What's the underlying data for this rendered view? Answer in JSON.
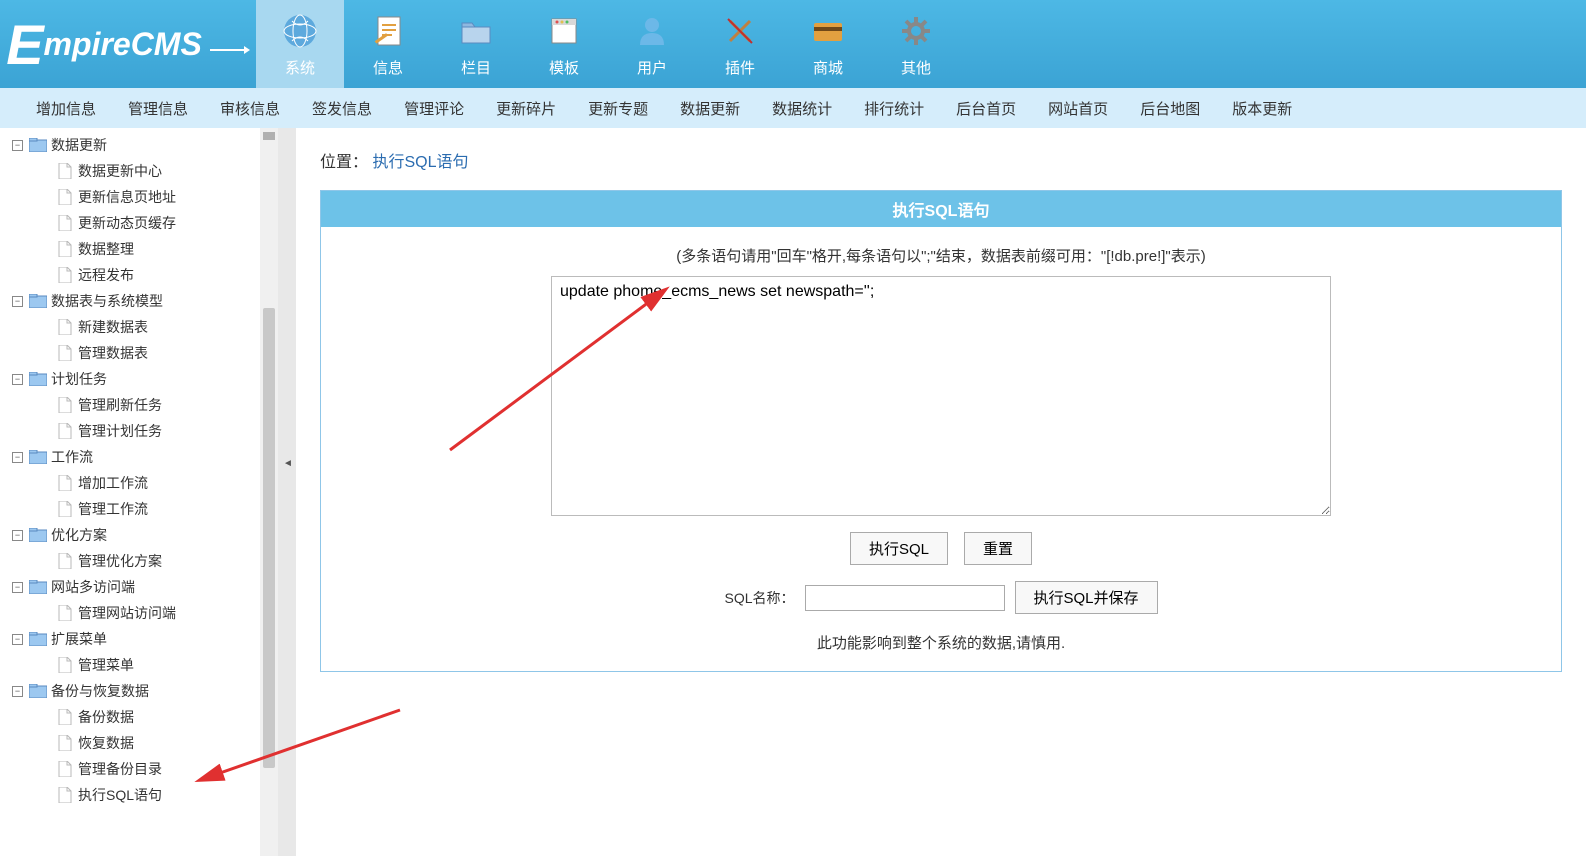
{
  "logo": "EmpireCMS",
  "topnav": [
    {
      "label": "系统",
      "icon": "globe",
      "active": true
    },
    {
      "label": "信息",
      "icon": "document"
    },
    {
      "label": "栏目",
      "icon": "folder"
    },
    {
      "label": "模板",
      "icon": "window"
    },
    {
      "label": "用户",
      "icon": "user"
    },
    {
      "label": "插件",
      "icon": "plugin"
    },
    {
      "label": "商城",
      "icon": "card"
    },
    {
      "label": "其他",
      "icon": "gear"
    }
  ],
  "subnav": [
    "增加信息",
    "管理信息",
    "审核信息",
    "签发信息",
    "管理评论",
    "更新碎片",
    "更新专题",
    "数据更新",
    "数据统计",
    "排行统计",
    "后台首页",
    "网站首页",
    "后台地图",
    "版本更新"
  ],
  "tree": [
    {
      "type": "node",
      "label": "数据更新",
      "children": [
        "数据更新中心",
        "更新信息页地址",
        "更新动态页缓存",
        "数据整理",
        "远程发布"
      ]
    },
    {
      "type": "node",
      "label": "数据表与系统模型",
      "children": [
        "新建数据表",
        "管理数据表"
      ]
    },
    {
      "type": "node",
      "label": "计划任务",
      "children": [
        "管理刷新任务",
        "管理计划任务"
      ]
    },
    {
      "type": "node",
      "label": "工作流",
      "children": [
        "增加工作流",
        "管理工作流"
      ]
    },
    {
      "type": "node",
      "label": "优化方案",
      "children": [
        "管理优化方案"
      ]
    },
    {
      "type": "node",
      "label": "网站多访问端",
      "children": [
        "管理网站访问端"
      ]
    },
    {
      "type": "node",
      "label": "扩展菜单",
      "children": [
        "管理菜单"
      ]
    },
    {
      "type": "node",
      "label": "备份与恢复数据",
      "children": [
        "备份数据",
        "恢复数据",
        "管理备份目录",
        "执行SQL语句"
      ]
    }
  ],
  "breadcrumb": {
    "label": "位置：",
    "page": "执行SQL语句"
  },
  "panel": {
    "title": "执行SQL语句",
    "hint": "(多条语句请用\"回车\"格开,每条语句以\";\"结束，数据表前缀可用：\"[!db.pre!]\"表示)",
    "sql_value": "update phome_ecms_news set newspath='';",
    "exec_btn": "执行SQL",
    "reset_btn": "重置",
    "name_label": "SQL名称：",
    "name_value": "",
    "save_btn": "执行SQL并保存",
    "warn": "此功能影响到整个系统的数据,请慎用."
  }
}
